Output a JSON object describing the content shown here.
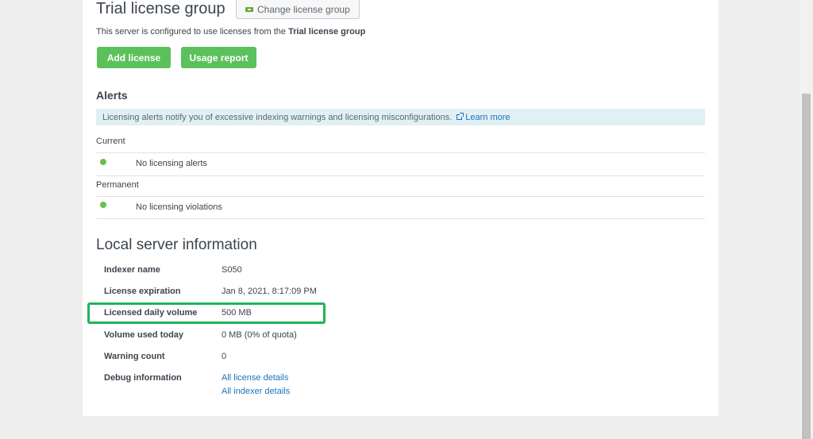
{
  "header": {
    "group_title": "Trial license group",
    "change_button_label": "Change license group",
    "configured_prefix": "This server is configured to use licenses from the",
    "configured_group": "Trial license group"
  },
  "actions": {
    "add_license_label": "Add license",
    "usage_report_label": "Usage report"
  },
  "alerts": {
    "title": "Alerts",
    "info_text": "Licensing alerts notify you of excessive indexing warnings and licensing misconfigurations.",
    "learn_more_label": "Learn more",
    "current_label": "Current",
    "current_message": "No licensing alerts",
    "permanent_label": "Permanent",
    "permanent_message": "No licensing violations",
    "status_color": "#65c14a"
  },
  "local_server": {
    "title": "Local server information",
    "rows": [
      {
        "label": "Indexer name",
        "value": "S050"
      },
      {
        "label": "License expiration",
        "value": "Jan 8, 2021, 8:17:09 PM"
      },
      {
        "label": "Licensed daily volume",
        "value": "500 MB"
      },
      {
        "label": "Volume used today",
        "value": "0 MB (0% of quota)"
      },
      {
        "label": "Warning count",
        "value": "0"
      }
    ],
    "debug_label": "Debug information",
    "debug_links": [
      "All license details",
      "All indexer details"
    ]
  },
  "colors": {
    "primary_button": "#5cc05c",
    "link": "#1a73ba",
    "highlight": "#21b35a",
    "info_bar": "#e1f0f5"
  }
}
